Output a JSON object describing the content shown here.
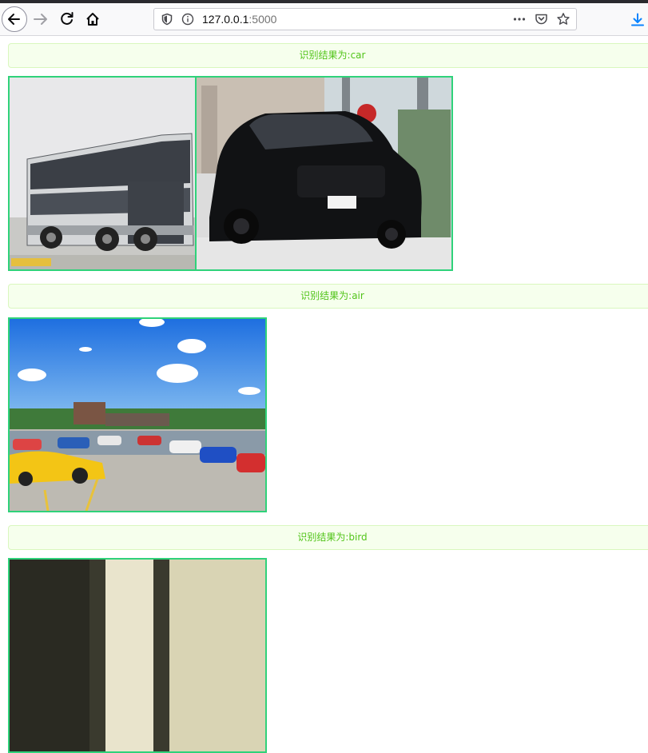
{
  "browser": {
    "url_host": "127.0.0.1",
    "url_port": ":5000",
    "icons": {
      "back": "back-arrow-icon",
      "forward": "forward-arrow-icon",
      "reload": "reload-icon",
      "home": "home-icon",
      "shield": "tracking-shield-icon",
      "info": "site-info-icon",
      "more": "page-actions-icon",
      "pocket": "pocket-icon",
      "bookmark": "star-icon",
      "download": "download-icon"
    }
  },
  "results": [
    {
      "label": "识别结果为:car"
    },
    {
      "label": "识别结果为:air"
    },
    {
      "label": "识别结果为:bird"
    }
  ],
  "colors": {
    "alert_bg": "#f6ffed",
    "alert_border": "#d9f7be",
    "alert_text": "#52c41a",
    "image_border": "#2fd27a"
  }
}
